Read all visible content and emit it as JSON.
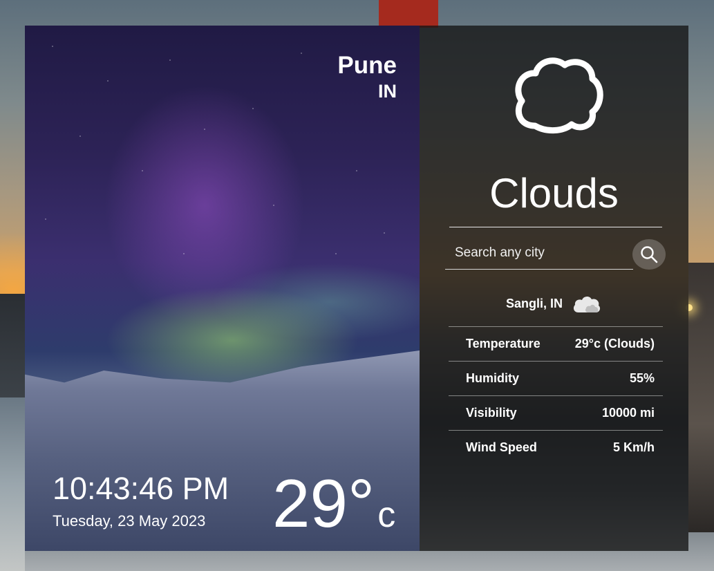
{
  "location": {
    "city": "Pune",
    "country": "IN"
  },
  "clock": {
    "time": "10:43:46 PM",
    "date": "Tuesday, 23 May 2023"
  },
  "temperature": {
    "value": "29°",
    "unit": "c"
  },
  "weather": {
    "condition": "Clouds",
    "icon": "cloud-icon"
  },
  "search": {
    "placeholder": "Search any city"
  },
  "result": {
    "location": "Sangli, IN",
    "icon": "cloud-icon"
  },
  "stats": [
    {
      "label": "Temperature",
      "value": "29°c (Clouds)"
    },
    {
      "label": "Humidity",
      "value": "55%"
    },
    {
      "label": "Visibility",
      "value": "10000 mi"
    },
    {
      "label": "Wind Speed",
      "value": "5 Km/h"
    }
  ]
}
